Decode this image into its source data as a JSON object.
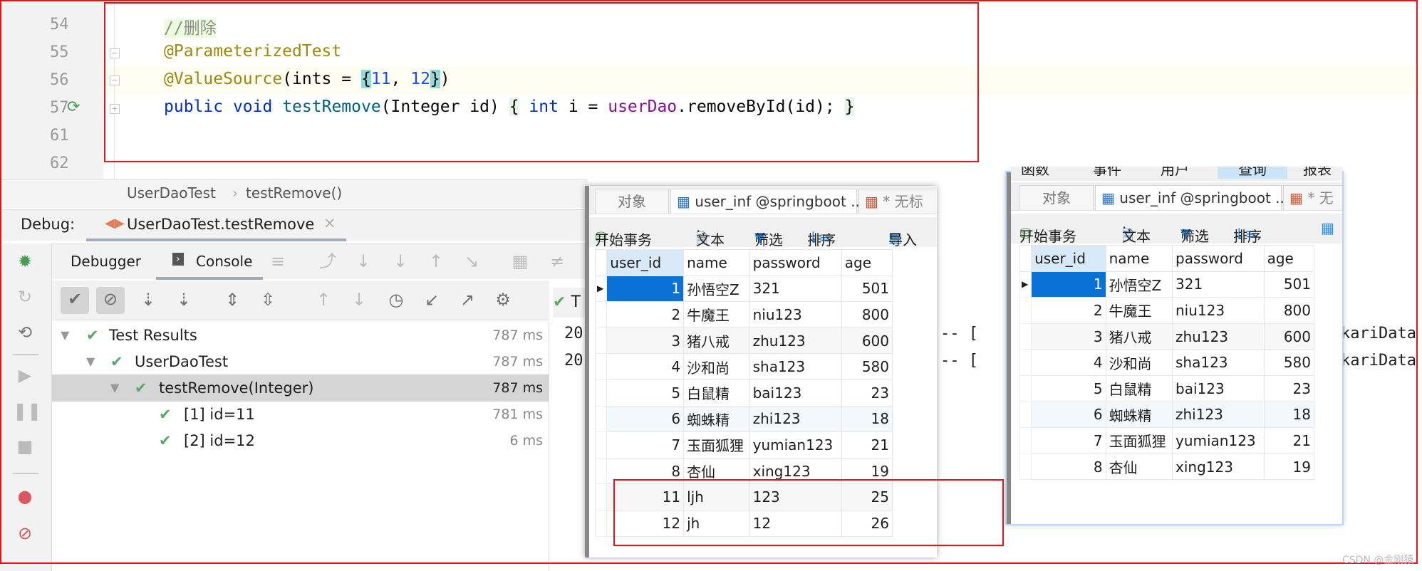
{
  "editor": {
    "line_numbers": [
      "54",
      "55",
      "56",
      "57",
      "61",
      "62"
    ],
    "lines": {
      "l54_comment": "//删除",
      "l55_annotation": "@ParameterizedTest",
      "l56_annotation": "@ValueSource",
      "l56_open": "(ints = ",
      "l56_brace_open": "{",
      "l56_v1": "11",
      "l56_sep": ", ",
      "l56_v2": "12",
      "l56_brace_close": "}",
      "l56_close": ")",
      "l57_public": "public",
      "l57_void": "void",
      "l57_method": "testRemove",
      "l57_params": "(Integer id) ",
      "l57_brace": "{",
      "l57_int": "int",
      "l57_var": " i = ",
      "l57_field": "userDao",
      "l57_call": ".removeById(id); ",
      "l57_end": "}"
    }
  },
  "breadcrumb": {
    "class": "UserDaoTest",
    "sep": "›",
    "method": "testRemove()"
  },
  "debug": {
    "label": "Debug:",
    "tab": "UserDaoTest.testRemove",
    "close": "×",
    "debugger_tab": "Debugger",
    "console_tab": "Console"
  },
  "tests": [
    {
      "label": "Test Results",
      "time": "787 ms"
    },
    {
      "label": "UserDaoTest",
      "time": "787 ms"
    },
    {
      "label": "testRemove(Integer)",
      "time": "787 ms"
    },
    {
      "label": "[1] id=11",
      "time": "781 ms"
    },
    {
      "label": "[2] id=12",
      "time": "6 ms"
    }
  ],
  "console": {
    "status_prefix": "T",
    "lines": [
      {
        "start": "20",
        "mid": "-- [",
        "end": "kariData"
      },
      {
        "start": "20",
        "mid": "-- [",
        "end": "kariData"
      }
    ]
  },
  "navicat_before": {
    "menu_items": [
      "函数",
      "事件",
      "用户",
      "查询",
      "报表"
    ],
    "tabs": [
      "对象",
      "user_inf @springboot ...",
      "* 无标"
    ],
    "toolbar": {
      "begin_tx": "开始事务",
      "text": "文本",
      "filter": "筛选",
      "sort": "排序",
      "import": "导入"
    },
    "columns": [
      "user_id",
      "name",
      "password",
      "age"
    ],
    "rows": [
      [
        "1",
        "孙悟空Z",
        "321",
        "501"
      ],
      [
        "2",
        "牛魔王",
        "niu123",
        "800"
      ],
      [
        "3",
        "猪八戒",
        "zhu123",
        "600"
      ],
      [
        "4",
        "沙和尚",
        "sha123",
        "580"
      ],
      [
        "5",
        "白鼠精",
        "bai123",
        "23"
      ],
      [
        "6",
        "蜘蛛精",
        "zhi123",
        "18"
      ],
      [
        "7",
        "玉面狐狸",
        "yumian123",
        "21"
      ],
      [
        "8",
        "杏仙",
        "xing123",
        "19"
      ],
      [
        "11",
        "ljh",
        "123",
        "25"
      ],
      [
        "12",
        "jh",
        "12",
        "26"
      ]
    ]
  },
  "navicat_after": {
    "tabs": [
      "对象",
      "user_inf @springboot ...",
      "* 无"
    ],
    "toolbar": {
      "begin_tx": "开始事务",
      "text": "文本",
      "filter": "筛选",
      "sort": "排序"
    },
    "columns": [
      "user_id",
      "name",
      "password",
      "age"
    ],
    "rows": [
      [
        "1",
        "孙悟空Z",
        "321",
        "501"
      ],
      [
        "2",
        "牛魔王",
        "niu123",
        "800"
      ],
      [
        "3",
        "猪八戒",
        "zhu123",
        "600"
      ],
      [
        "4",
        "沙和尚",
        "sha123",
        "580"
      ],
      [
        "5",
        "白鼠精",
        "bai123",
        "23"
      ],
      [
        "6",
        "蜘蛛精",
        "zhi123",
        "18"
      ],
      [
        "7",
        "玉面狐狸",
        "yumian123",
        "21"
      ],
      [
        "8",
        "杏仙",
        "xing123",
        "19"
      ]
    ]
  },
  "watermark": "CSDN @金刚猿",
  "colors": {
    "highlight_red": "#e8141c",
    "selected_cell": "#0a72d6",
    "pass_green": "#59a869"
  }
}
